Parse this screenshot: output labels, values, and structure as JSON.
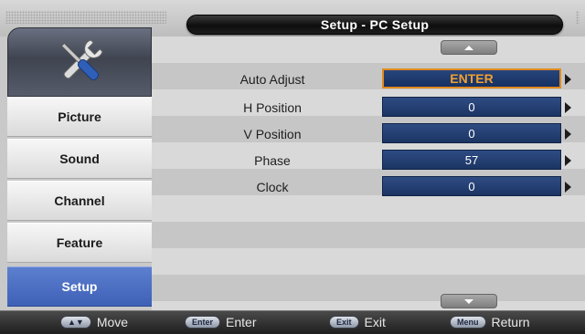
{
  "window": {
    "title": "Setup - PC Setup"
  },
  "sidebar": {
    "logo_icon": "tools-icon",
    "items": [
      {
        "label": "Picture",
        "active": false
      },
      {
        "label": "Sound",
        "active": false
      },
      {
        "label": "Channel",
        "active": false
      },
      {
        "label": "Feature",
        "active": false
      },
      {
        "label": "Setup",
        "active": true
      }
    ]
  },
  "settings": [
    {
      "label": "Auto Adjust",
      "value": "ENTER",
      "selected": true
    },
    {
      "label": "H Position",
      "value": "0",
      "selected": false
    },
    {
      "label": "V Position",
      "value": "0",
      "selected": false
    },
    {
      "label": "Phase",
      "value": "57",
      "selected": false
    },
    {
      "label": "Clock",
      "value": "0",
      "selected": false
    }
  ],
  "hints": [
    {
      "key": "▲▼",
      "label": "Move"
    },
    {
      "key": "Enter",
      "label": "Enter"
    },
    {
      "key": "Exit",
      "label": "Exit"
    },
    {
      "key": "Menu",
      "label": "Return"
    }
  ],
  "colors": {
    "accent_active": "#4a6cc3",
    "value_box": "#1f3a6e",
    "selection_border": "#e08a1e",
    "selected_text": "#f0a030"
  }
}
